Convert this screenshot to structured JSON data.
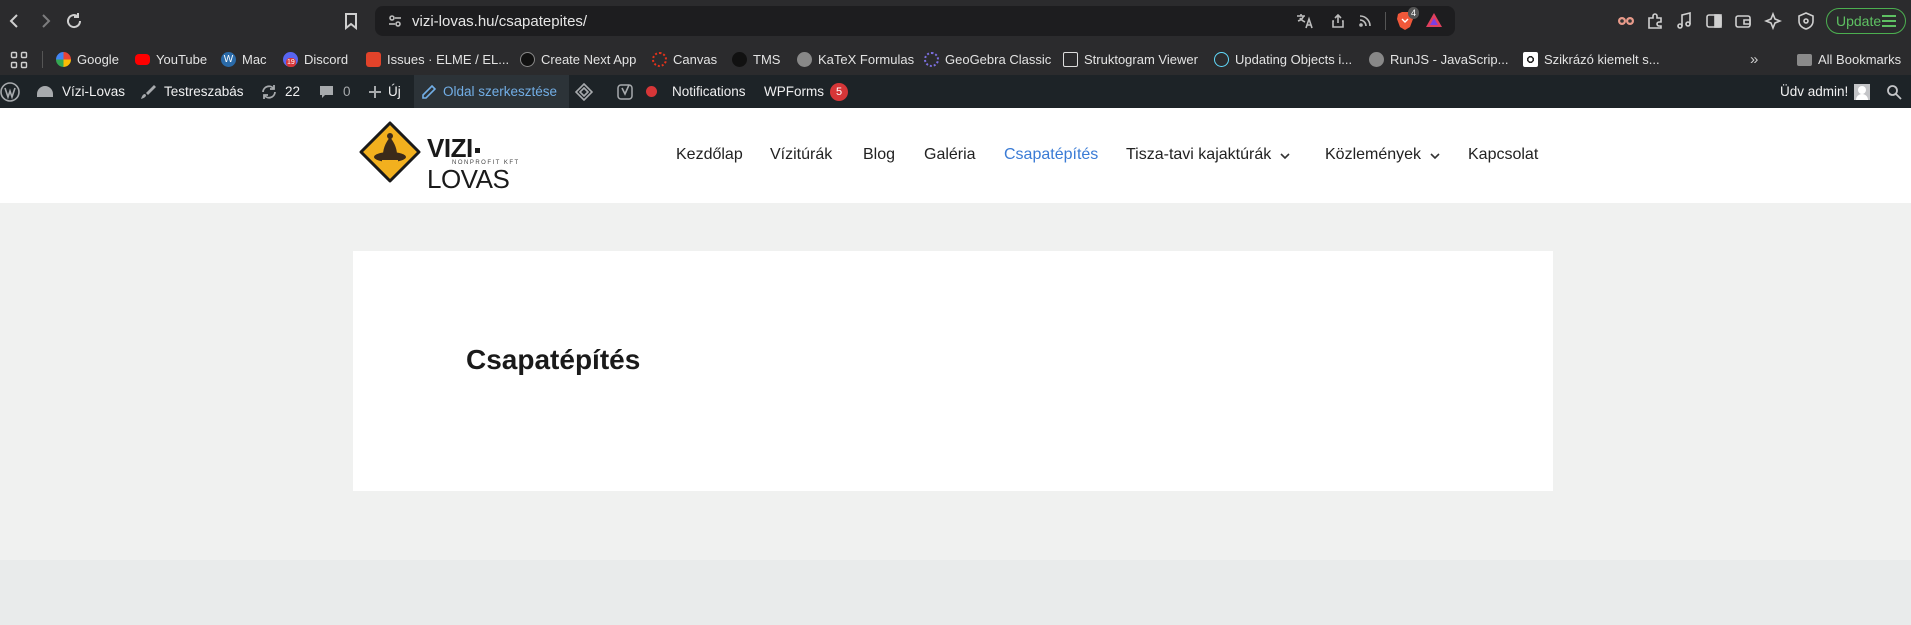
{
  "browser": {
    "url": "vizi-lovas.hu/csapatepites/",
    "update_label": "Update",
    "brave_badge": "4"
  },
  "bookmarks": {
    "items": [
      {
        "label": "Google",
        "icon": "google-icon"
      },
      {
        "label": "YouTube",
        "icon": "youtube-icon"
      },
      {
        "label": "Mac",
        "icon": "wordpress-icon"
      },
      {
        "label": "Discord",
        "icon": "discord-icon",
        "badge": "19"
      },
      {
        "label": "Issues · ELME / EL...",
        "icon": "gitlab-icon"
      },
      {
        "label": "Create Next App",
        "icon": "nextjs-icon"
      },
      {
        "label": "Canvas",
        "icon": "canvas-icon"
      },
      {
        "label": "TMS",
        "icon": "tms-icon"
      },
      {
        "label": "KaTeX Formulas",
        "icon": "globe-icon"
      },
      {
        "label": "GeoGebra Classic",
        "icon": "geogebra-icon"
      },
      {
        "label": "Struktogram Viewer",
        "icon": "struktogram-icon"
      },
      {
        "label": "Updating Objects i...",
        "icon": "react-icon"
      },
      {
        "label": "RunJS - JavaScrip...",
        "icon": "globe-icon"
      },
      {
        "label": "Szikrázó kiemelt s...",
        "icon": "szikrazo-icon"
      }
    ],
    "all_bookmarks": "All Bookmarks"
  },
  "admin_bar": {
    "site_name": "Vízi-Lovas",
    "customize": "Testreszabás",
    "updates": "22",
    "comments": "0",
    "new": "Új",
    "edit_page": "Oldal szerkesztése",
    "notifications": "Notifications",
    "wpforms": "WPForms",
    "wpforms_badge": "5",
    "greeting": "Üdv admin!"
  },
  "site": {
    "logo_main": "VIZI",
    "logo_second": "LOVAS",
    "logo_sub": "NONPROFIT KFT",
    "nav": [
      {
        "label": "Kezdőlap"
      },
      {
        "label": "Vízitúrák"
      },
      {
        "label": "Blog"
      },
      {
        "label": "Galéria"
      },
      {
        "label": "Csapatépítés",
        "active": true
      },
      {
        "label": "Tisza-tavi kajaktúrák",
        "dropdown": true
      },
      {
        "label": "Közlemények",
        "dropdown": true
      },
      {
        "label": "Kapcsolat"
      }
    ],
    "active_color": "#3a7bd5"
  },
  "page": {
    "title": "Csapatépítés"
  }
}
